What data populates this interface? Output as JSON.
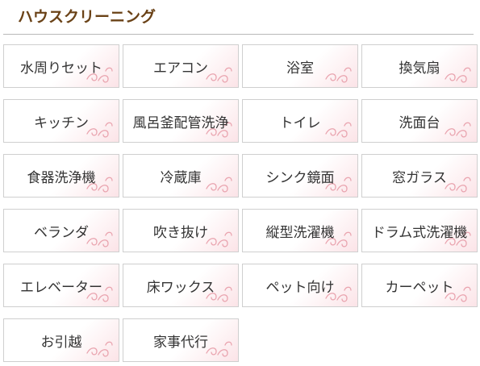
{
  "header": {
    "title": "ハウスクリーニング"
  },
  "colors": {
    "title": "#6a4217",
    "tile_border": "#cfcfcf",
    "tile_gradient": "#fbe3e7",
    "divider": "#b8b8b8",
    "decoration": "#e9a3ae"
  },
  "decoration_icon": "swirl-flourish-icon",
  "services": [
    {
      "label": "水周りセット"
    },
    {
      "label": "エアコン"
    },
    {
      "label": "浴室"
    },
    {
      "label": "換気扇"
    },
    {
      "label": "キッチン"
    },
    {
      "label": "風呂釜配管洗浄"
    },
    {
      "label": "トイレ"
    },
    {
      "label": "洗面台"
    },
    {
      "label": "食器洗浄機"
    },
    {
      "label": "冷蔵庫"
    },
    {
      "label": "シンク鏡面"
    },
    {
      "label": "窓ガラス"
    },
    {
      "label": "ベランダ"
    },
    {
      "label": "吹き抜け"
    },
    {
      "label": "縦型洗濯機"
    },
    {
      "label": "ドラム式洗濯機"
    },
    {
      "label": "エレベーター"
    },
    {
      "label": "床ワックス"
    },
    {
      "label": "ペット向け"
    },
    {
      "label": "カーペット"
    },
    {
      "label": "お引越"
    },
    {
      "label": "家事代行"
    }
  ]
}
